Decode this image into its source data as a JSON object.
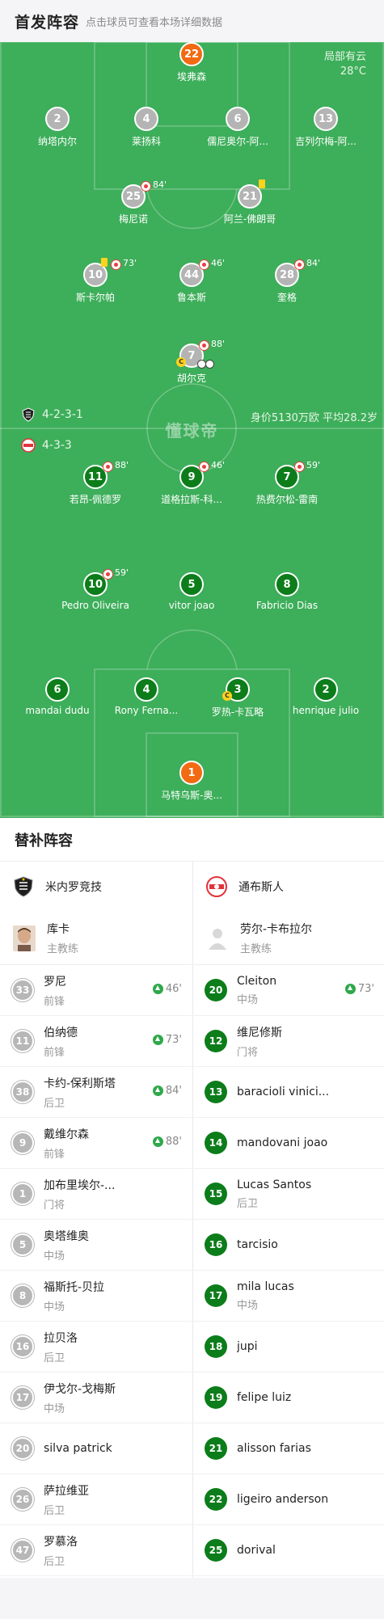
{
  "header": {
    "title": "首发阵容",
    "subtitle": "点击球员可查看本场详细数据"
  },
  "weather": {
    "desc": "局部有云",
    "temp": "28°C"
  },
  "home": {
    "formation": "4-2-3-1",
    "players": [
      {
        "num": "22",
        "name": "埃弗森",
        "style": "orange"
      },
      {
        "num": "2",
        "name": "纳塔内尔",
        "style": "grey"
      },
      {
        "num": "4",
        "name": "莱扬科",
        "style": "grey"
      },
      {
        "num": "6",
        "name": "儒尼奥尔-阿...",
        "style": "grey"
      },
      {
        "num": "13",
        "name": "吉列尔梅-阿...",
        "style": "grey"
      },
      {
        "num": "25",
        "name": "梅尼诺",
        "style": "grey",
        "sub": "84'"
      },
      {
        "num": "21",
        "name": "阿兰-佛朗哥",
        "style": "grey",
        "yellow": true
      },
      {
        "num": "10",
        "name": "斯卡尔帕",
        "style": "grey",
        "yellow": true,
        "sub": "73'"
      },
      {
        "num": "44",
        "name": "鲁本斯",
        "style": "grey",
        "sub": "46'"
      },
      {
        "num": "28",
        "name": "奎格",
        "style": "grey",
        "sub": "84'"
      },
      {
        "num": "7",
        "name": "胡尔克",
        "style": "grey",
        "sub": "88'",
        "captain": "C",
        "goals": 2
      }
    ]
  },
  "mid": {
    "watermark": "懂球帝",
    "market_value": "身价5130万欧 平均28.2岁"
  },
  "away": {
    "formation": "4-3-3",
    "players": [
      {
        "num": "11",
        "name": "若昂-佩德罗",
        "style": "green",
        "sub": "88'"
      },
      {
        "num": "9",
        "name": "道格拉斯-科...",
        "style": "green",
        "sub": "46'"
      },
      {
        "num": "7",
        "name": "热费尔松-雷南",
        "style": "green",
        "sub": "59'"
      },
      {
        "num": "10",
        "name": "Pedro Oliveira",
        "style": "green",
        "sub": "59'"
      },
      {
        "num": "5",
        "name": "vitor joao",
        "style": "green"
      },
      {
        "num": "8",
        "name": "Fabricio Dias",
        "style": "green"
      },
      {
        "num": "6",
        "name": "mandai dudu",
        "style": "green"
      },
      {
        "num": "4",
        "name": "Rony Ferna...",
        "style": "green"
      },
      {
        "num": "3",
        "name": "罗热-卡瓦略",
        "style": "green",
        "captain": "C"
      },
      {
        "num": "2",
        "name": "henrique julio",
        "style": "green"
      },
      {
        "num": "1",
        "name": "马特乌斯-奥...",
        "style": "orange"
      }
    ]
  },
  "subs": {
    "title": "替补阵容",
    "left": {
      "team": "米内罗竞技",
      "coach": {
        "name": "库卡",
        "role": "主教练"
      },
      "players": [
        {
          "num": "33",
          "name": "罗尼",
          "pos": "前锋",
          "in": "46'"
        },
        {
          "num": "11",
          "name": "伯纳德",
          "pos": "前锋",
          "in": "73'"
        },
        {
          "num": "38",
          "name": "卡约-保利斯塔",
          "pos": "后卫",
          "in": "84'"
        },
        {
          "num": "9",
          "name": "戴维尔森",
          "pos": "前锋",
          "in": "88'"
        },
        {
          "num": "1",
          "name": "加布里埃尔-...",
          "pos": "门将"
        },
        {
          "num": "5",
          "name": "奥塔维奥",
          "pos": "中场"
        },
        {
          "num": "8",
          "name": "福斯托-贝拉",
          "pos": "中场"
        },
        {
          "num": "16",
          "name": "拉贝洛",
          "pos": "后卫"
        },
        {
          "num": "17",
          "name": "伊戈尔-戈梅斯",
          "pos": "中场"
        },
        {
          "num": "20",
          "name": "silva patrick",
          "pos": ""
        },
        {
          "num": "26",
          "name": "萨拉维亚",
          "pos": "后卫"
        },
        {
          "num": "47",
          "name": "罗慕洛",
          "pos": "后卫"
        }
      ]
    },
    "right": {
      "team": "通布斯人",
      "coach": {
        "name": "劳尔-卡布拉尔",
        "role": "主教练"
      },
      "players": [
        {
          "num": "20",
          "name": "Cleiton",
          "pos": "中场",
          "in": "73'"
        },
        {
          "num": "12",
          "name": "维尼修斯",
          "pos": "门将"
        },
        {
          "num": "13",
          "name": "baracioli vinici...",
          "pos": ""
        },
        {
          "num": "14",
          "name": "mandovani joao",
          "pos": ""
        },
        {
          "num": "15",
          "name": "Lucas Santos",
          "pos": "后卫"
        },
        {
          "num": "16",
          "name": "tarcisio",
          "pos": ""
        },
        {
          "num": "17",
          "name": "mila lucas",
          "pos": "中场"
        },
        {
          "num": "18",
          "name": "jupi",
          "pos": ""
        },
        {
          "num": "19",
          "name": "felipe luiz",
          "pos": ""
        },
        {
          "num": "21",
          "name": "alisson farias",
          "pos": ""
        },
        {
          "num": "22",
          "name": "ligeiro anderson",
          "pos": ""
        },
        {
          "num": "25",
          "name": "dorival",
          "pos": ""
        }
      ]
    }
  }
}
